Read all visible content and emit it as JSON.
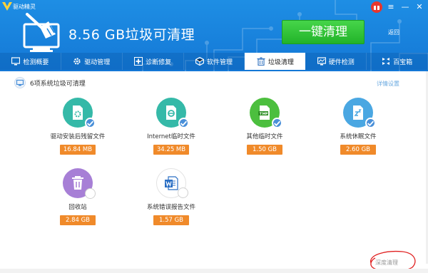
{
  "app": {
    "name": "驱动精灵"
  },
  "header": {
    "headline": "8.56 GB垃圾可清理",
    "clean_button": "一键清理",
    "back_label": "返回"
  },
  "tabs": [
    {
      "label": "检测概要",
      "icon": "monitor-icon"
    },
    {
      "label": "驱动管理",
      "icon": "gear-icon"
    },
    {
      "label": "诊断修复",
      "icon": "plus-icon"
    },
    {
      "label": "软件管理",
      "icon": "cube-icon"
    },
    {
      "label": "垃圾清理",
      "icon": "trash-icon",
      "active": true
    },
    {
      "label": "硬件检测",
      "icon": "chart-icon"
    },
    {
      "label": "百宝箱",
      "icon": "box-icon"
    }
  ],
  "summary": {
    "text": "6项系统垃圾可清理",
    "settings_label": "详情设置"
  },
  "items": [
    {
      "label": "驱动安装后残留文件",
      "size": "16.84 MB",
      "color": "#35b9a8",
      "icon": "document-gear-icon",
      "checked": true
    },
    {
      "label": "Internet临时文件",
      "size": "34.25 MB",
      "color": "#35b9a8",
      "icon": "internet-file-icon",
      "checked": true
    },
    {
      "label": "其他临时文件",
      "size": "1.50 GB",
      "color": "#4cbf3e",
      "icon": "tmp-file-icon",
      "checked": true
    },
    {
      "label": "系统休眠文件",
      "size": "2.60 GB",
      "color": "#4aa7e2",
      "icon": "sleep-file-icon",
      "checked": true
    },
    {
      "label": "回收站",
      "size": "2.84 GB",
      "color": "#a77fd6",
      "icon": "recycle-bin-icon",
      "checked": false
    },
    {
      "label": "系统错误报告文件",
      "size": "1.57 GB",
      "color": "#ffffff",
      "icon": "word-report-icon",
      "checked": false
    }
  ],
  "footer": {
    "deep_clean_label": "深度清理"
  },
  "colors": {
    "header_blue": "#1a84de",
    "green_button": "#2fc233",
    "size_badge": "#f08a2a",
    "check_blue": "#4a90d9"
  }
}
